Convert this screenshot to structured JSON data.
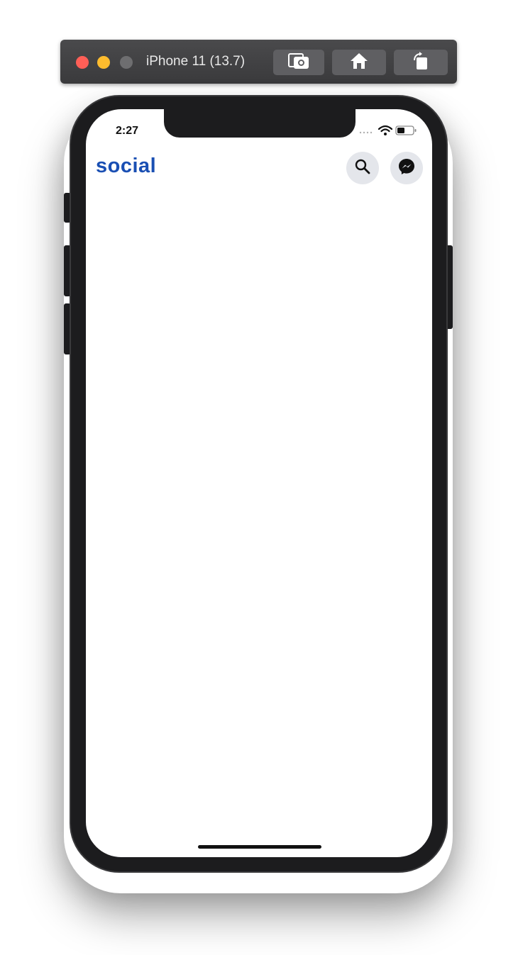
{
  "simulator": {
    "title": "iPhone 11 (13.7)",
    "toolbar_icons": [
      "screenshot-icon",
      "home-icon",
      "rotate-icon"
    ]
  },
  "status_bar": {
    "time": "2:27",
    "icons": [
      "cellular-icon",
      "wifi-icon",
      "battery-icon"
    ]
  },
  "app": {
    "title": "social",
    "title_color": "#1a4fb3",
    "header_icons": [
      "search-icon",
      "messenger-icon"
    ],
    "icon_button_bg": "#e4e6eb"
  }
}
